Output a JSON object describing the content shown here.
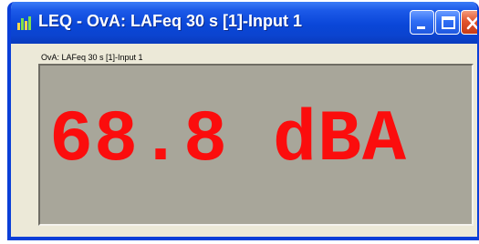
{
  "window": {
    "title": "LEQ - OvA: LAFeq 30 s [1]-Input 1",
    "app_icon": "bar-chart-icon",
    "controls": [
      "minimize-icon",
      "maximize-icon",
      "close-icon"
    ]
  },
  "panel": {
    "label": "OvA: LAFeq 30 s [1]-Input 1"
  },
  "meter": {
    "reading": "68.8 dBA",
    "value": 68.8,
    "unit": "dBA",
    "text_color": "#fb0d0d",
    "background_color": "#a8a69a"
  },
  "colors": {
    "titlebar": "#0a46d8",
    "window_face": "#ece9d8"
  }
}
